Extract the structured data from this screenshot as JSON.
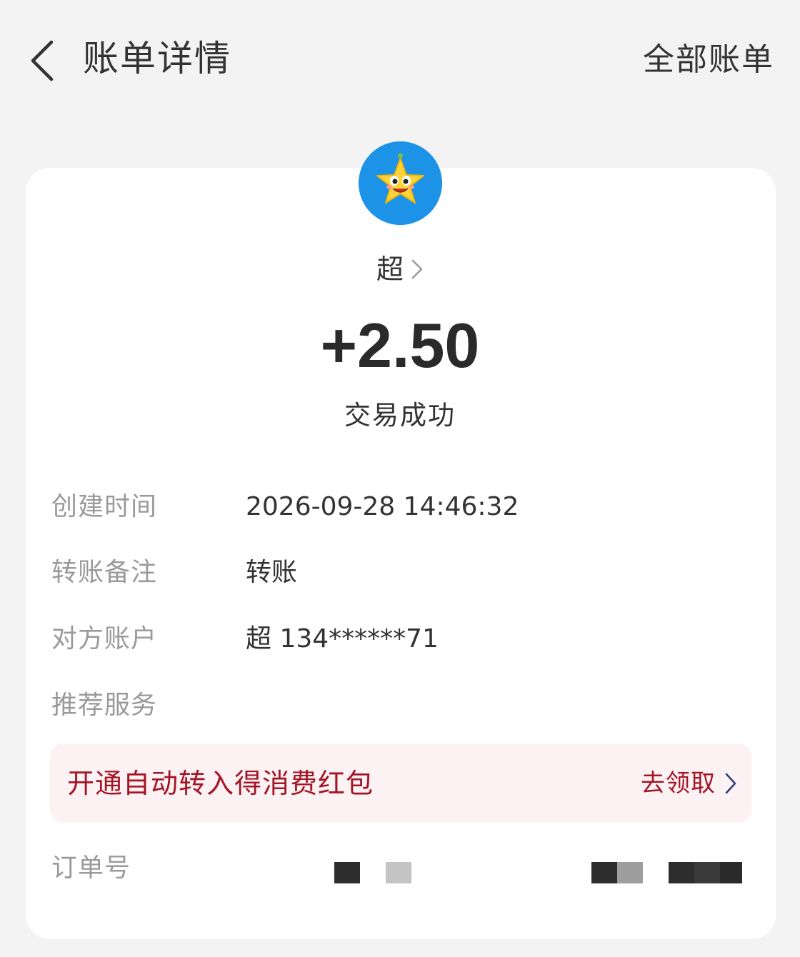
{
  "header": {
    "title": "账单详情",
    "all_bills_label": "全部账单"
  },
  "transaction": {
    "payer_name": "超",
    "amount": "+2.50",
    "status": "交易成功"
  },
  "details": [
    {
      "label": "创建时间",
      "value": "2026-09-28 14:46:32"
    },
    {
      "label": "转账备注",
      "value": "转账"
    },
    {
      "label": "对方账户",
      "value": "超 134******71"
    },
    {
      "label": "推荐服务",
      "value": ""
    }
  ],
  "promo": {
    "text": "开通自动转入得消费红包",
    "action_label": "去领取"
  },
  "order": {
    "label": "订单号"
  },
  "colors": {
    "background": "#f3f3f3",
    "card": "#ffffff",
    "promo_bg": "#fdf2f3",
    "promo_text": "#a31626",
    "label_gray": "#9a9a9a",
    "avatar_bg": "#1d93e8"
  },
  "icons": [
    "back-arrow-icon",
    "chevron-right-icon",
    "star-avatar-icon"
  ]
}
